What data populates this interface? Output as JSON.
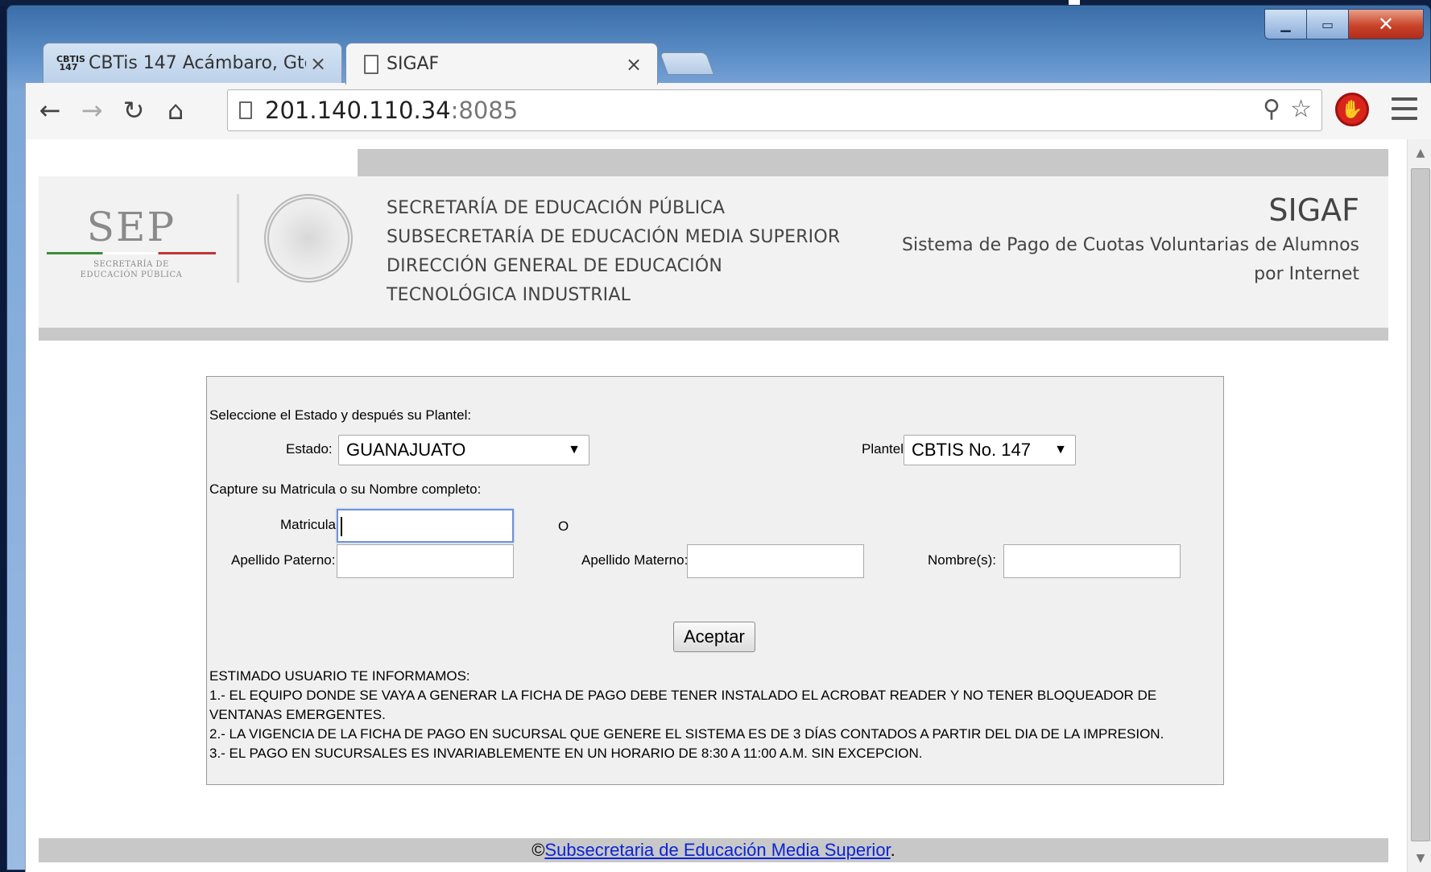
{
  "browser": {
    "tabs": [
      {
        "favicon": "CBTIS 147",
        "title": "CBTis 147 Acámbaro, Gto.",
        "close": "×"
      },
      {
        "favicon": "page-icon",
        "title": "SIGAF",
        "close": "×"
      }
    ],
    "url_host": "201.140.110.34",
    "url_port": ":8085",
    "window_controls": {
      "close": "✕"
    }
  },
  "header": {
    "logo_text": "SEP",
    "logo_sub1": "SECRETARÍA DE",
    "logo_sub2": "EDUCACIÓN PÚBLICA",
    "lines": [
      "SECRETARÍA DE EDUCACIÓN PÚBLICA",
      "SUBSECRETARÍA DE EDUCACIÓN MEDIA SUPERIOR",
      "DIRECCIÓN GENERAL DE EDUCACIÓN",
      "TECNOLÓGICA INDUSTRIAL"
    ],
    "app_name": "SIGAF",
    "app_desc_1": "Sistema de Pago de Cuotas Voluntarias de Alumnos",
    "app_desc_2": "por Internet"
  },
  "form": {
    "instruction_1": "Seleccione el Estado y después su Plantel:",
    "estado_label": "Estado:",
    "estado_value": "GUANAJUATO",
    "plantel_label": "Plantel:",
    "plantel_value": "CBTIS No. 147",
    "instruction_2": "Capture su Matricula o su Nombre completo:",
    "matricula_label": "Matricula:",
    "or_text": "O",
    "ap_paterno_label": "Apellido Paterno:",
    "ap_materno_label": "Apellido Materno:",
    "nombre_label": "Nombre(s):",
    "submit_label": "Aceptar",
    "notice": [
      "ESTIMADO USUARIO TE INFORMAMOS:",
      "1.- EL EQUIPO DONDE SE VAYA A GENERAR LA FICHA DE PAGO DEBE TENER INSTALADO EL ACROBAT READER Y NO TENER BLOQUEADOR DE VENTANAS EMERGENTES.",
      "2.- LA VIGENCIA DE LA FICHA DE PAGO EN SUCURSAL QUE GENERE EL SISTEMA ES DE 3 DÍAS CONTADOS A PARTIR DEL DIA DE LA IMPRESION.",
      "3.- EL PAGO EN SUCURSALES ES INVARIABLEMENTE EN UN HORARIO DE 8:30 A 11:00 A.M. SIN EXCEPCION."
    ]
  },
  "footer": {
    "copyright": "©",
    "link_text": "Subsecretaria de Educación Media Superior",
    "suffix": "."
  }
}
